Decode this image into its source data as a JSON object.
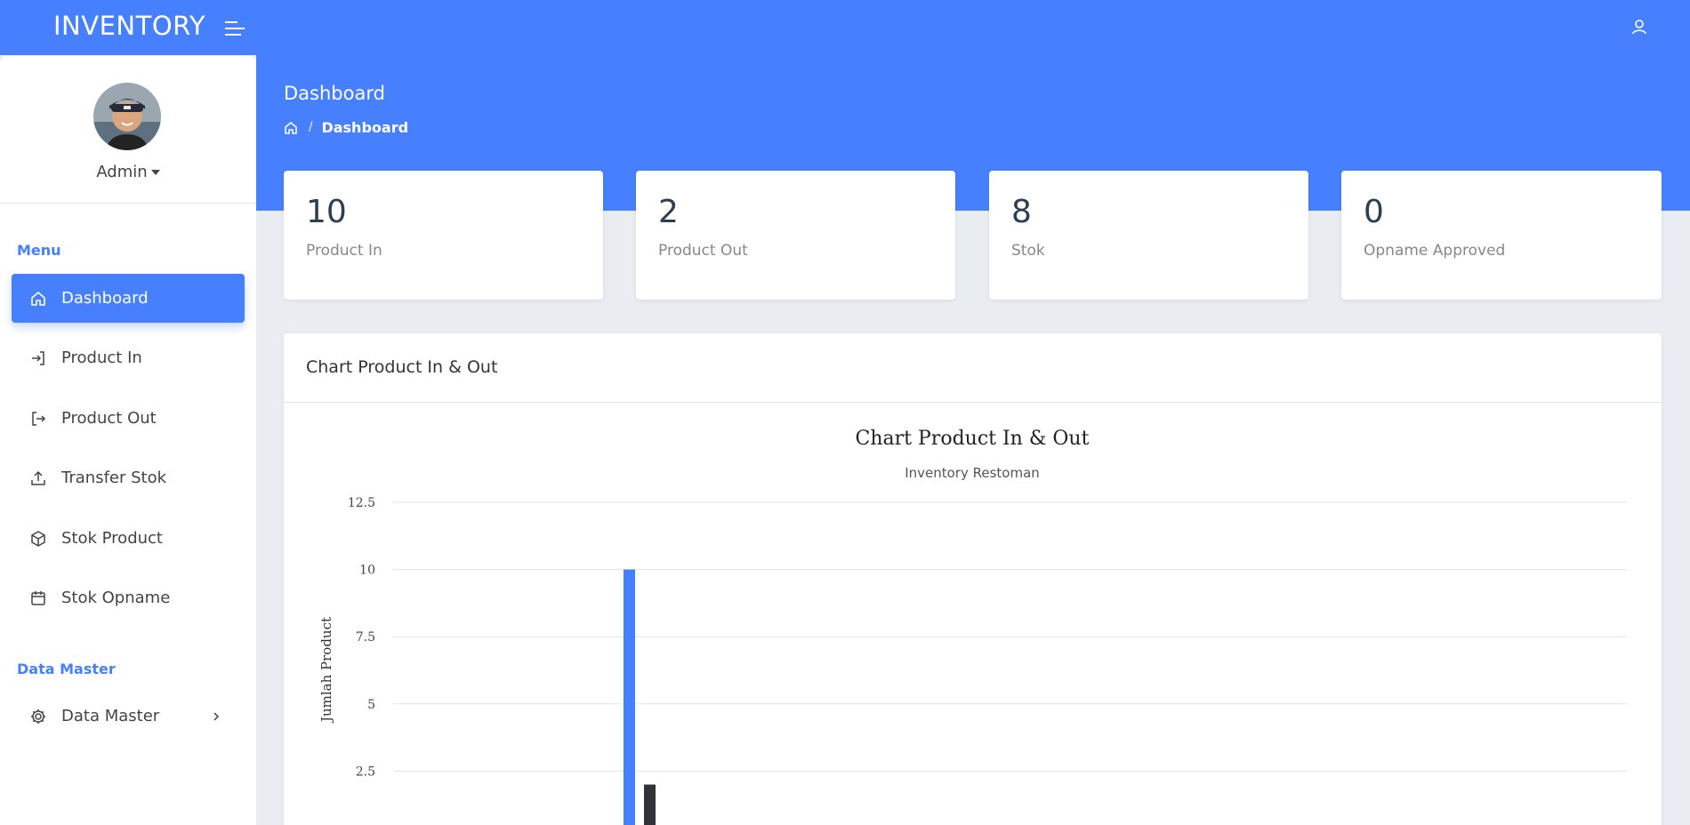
{
  "app": {
    "brand": "INVENTORY"
  },
  "header": {
    "page_title": "Dashboard",
    "breadcrumb_current": "Dashboard",
    "breadcrumb_sep": "/"
  },
  "sidebar": {
    "user_name": "Admin",
    "menu_label": "Menu",
    "items": [
      {
        "label": "Dashboard",
        "icon": "home-icon",
        "active": true
      },
      {
        "label": "Product In",
        "icon": "login-icon"
      },
      {
        "label": "Product Out",
        "icon": "logout-icon"
      },
      {
        "label": "Transfer Stok",
        "icon": "upload-icon"
      },
      {
        "label": "Stok Product",
        "icon": "box-icon"
      },
      {
        "label": "Stok Opname",
        "icon": "calendar-icon"
      }
    ],
    "data_master_label": "Data Master",
    "data_master_item": {
      "label": "Data Master",
      "icon": "gear-icon"
    }
  },
  "stats": [
    {
      "value": "10",
      "label": "Product In"
    },
    {
      "value": "2",
      "label": "Product Out"
    },
    {
      "value": "8",
      "label": "Stok"
    },
    {
      "value": "0",
      "label": "Opname Approved"
    }
  ],
  "chart_card": {
    "title": "Chart Product In & Out"
  },
  "colors": {
    "accent": "#4680ff",
    "series_out": "#2f3338"
  },
  "chart_data": {
    "type": "bar",
    "title": "Chart Product In & Out",
    "subtitle": "Inventory Restoman",
    "ylabel": "Jumlah Product",
    "ylim": [
      0,
      12.5
    ],
    "yticks": [
      "12.5",
      "10",
      "7.5",
      "5",
      "2.5"
    ],
    "yticks_values": [
      12.5,
      10,
      7.5,
      5,
      2.5
    ],
    "series": [
      {
        "values": [
          10
        ],
        "color": "#4680ff"
      },
      {
        "values": [
          2
        ],
        "color": "#2f3338"
      }
    ]
  }
}
